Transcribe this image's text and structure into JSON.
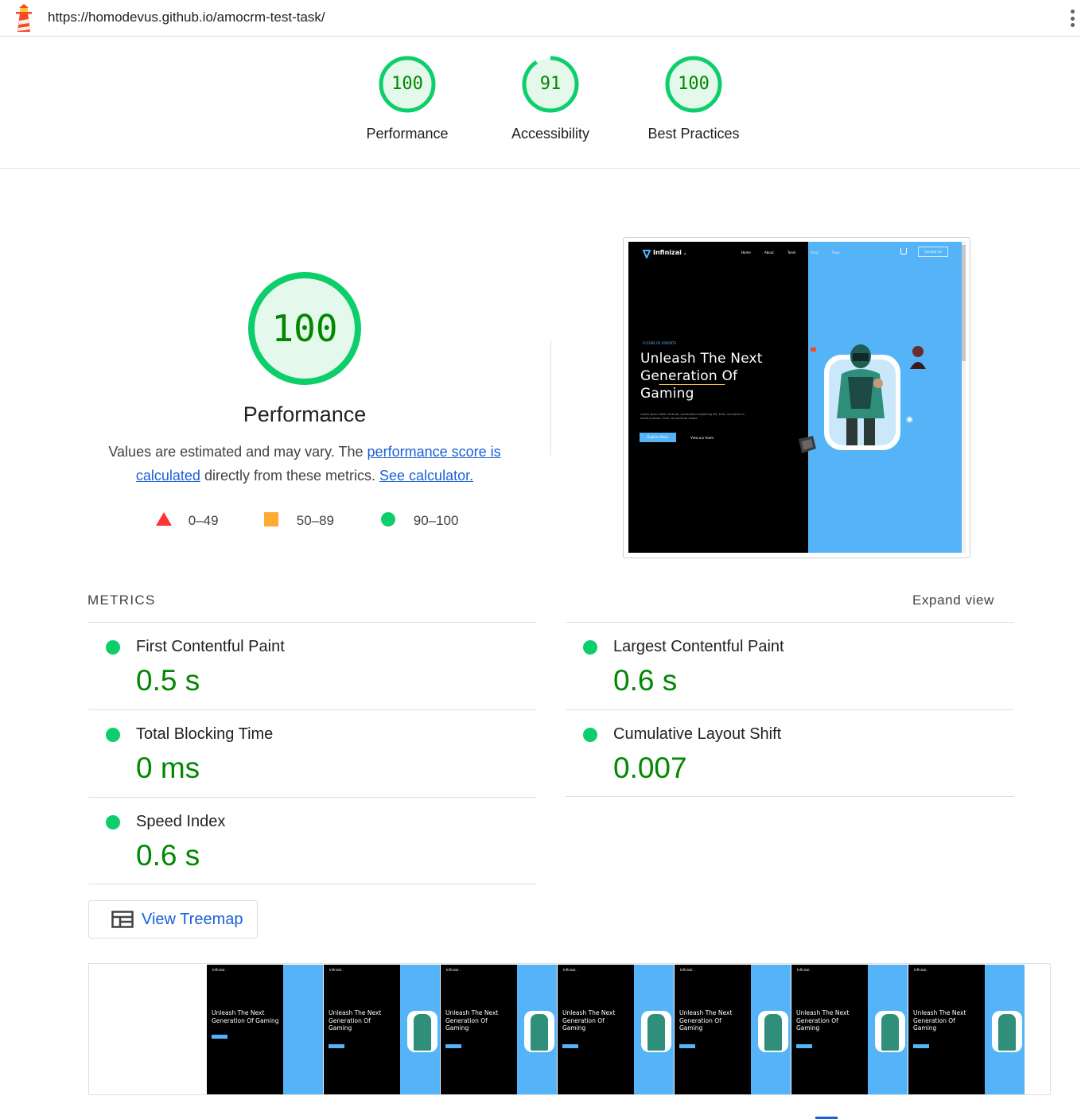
{
  "browser": {
    "url": "https://homodevus.github.io/amocrm-test-task/",
    "logo_icon": "lighthouse-icon",
    "menu_icon": "more-vert-icon"
  },
  "summary": [
    {
      "score": "100",
      "label": "Performance",
      "fraction": 1.0
    },
    {
      "score": "91",
      "label": "Accessibility",
      "fraction": 0.91
    },
    {
      "score": "100",
      "label": "Best Practices",
      "fraction": 1.0
    }
  ],
  "performance": {
    "score": "100",
    "title": "Performance",
    "desc_prefix": "Values are estimated and may vary. The ",
    "link_score": "performance score is calculated",
    "desc_middle": " directly from these metrics. ",
    "link_calc": "See calculator.",
    "legend": [
      {
        "range": "0–49",
        "shape": "triangle",
        "color": "#ff3333"
      },
      {
        "range": "50–89",
        "shape": "square",
        "color": "#ffaa33"
      },
      {
        "range": "90–100",
        "shape": "circle",
        "color": "#0cce6b"
      }
    ]
  },
  "preview": {
    "brand": "Infinizai .",
    "nav": [
      "Home",
      "About",
      "Team",
      "Shop",
      "Page"
    ],
    "contact": "Contact Us",
    "tag": "FUTURE OF ESPORTS",
    "headline": [
      "Unleash The Next",
      "Generation Of",
      "Gaming"
    ],
    "body": [
      "Lorem ipsum dolor sit amet, consectetur adipiscing elit. Felis, nisi donec in",
      "morbi pulvinar. Enim non pulvinar neque."
    ],
    "primary_button": "Explore More",
    "secondary_link": "View our team"
  },
  "metrics": {
    "heading": "METRICS",
    "expand_label": "Expand view",
    "items": [
      {
        "name": "First Contentful Paint",
        "value": "0.5 s"
      },
      {
        "name": "Largest Contentful Paint",
        "value": "0.6 s"
      },
      {
        "name": "Total Blocking Time",
        "value": "0 ms"
      },
      {
        "name": "Cumulative Layout Shift",
        "value": "0.007"
      },
      {
        "name": "Speed Index",
        "value": "0.6 s"
      }
    ],
    "status_color": "#0cce6b"
  },
  "treemap": {
    "label": "View Treemap",
    "icon": "treemap-icon"
  },
  "filmstrip": {
    "frame_count": 8,
    "frames": [
      {
        "state": "blank"
      },
      {
        "state": "partial",
        "headline": [
          "Unleash The Next",
          "Generation Of Gaming"
        ]
      },
      {
        "state": "full",
        "headline": [
          "Unleash The Next",
          "Generation Of",
          "Gaming"
        ]
      },
      {
        "state": "full",
        "headline": [
          "Unleash The Next",
          "Generation Of",
          "Gaming"
        ]
      },
      {
        "state": "full",
        "headline": [
          "Unleash The Next",
          "Generation Of",
          "Gaming"
        ]
      },
      {
        "state": "full",
        "headline": [
          "Unleash The Next",
          "Generation Of",
          "Gaming"
        ]
      },
      {
        "state": "full",
        "headline": [
          "Unleash The Next",
          "Generation Of",
          "Gaming"
        ]
      },
      {
        "state": "full",
        "headline": [
          "Unleash The Next",
          "Generation Of",
          "Gaming"
        ]
      }
    ]
  },
  "colors": {
    "pass": "#0cce6b",
    "pass_text": "#008800",
    "link": "#1a5fd6",
    "preview_blue": "#55b4f8"
  }
}
